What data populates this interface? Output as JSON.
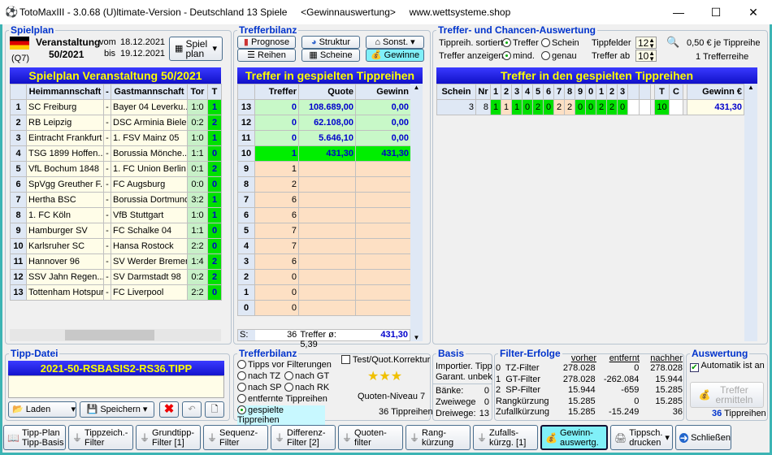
{
  "window": {
    "title": "TotoMaxIII - 3.0.68 (U)ltimate-Version - Deutschland 13 Spiele     <Gewinnauswertung>     www.wettsysteme.shop",
    "minimize": "—",
    "maximize": "☐",
    "close": "✕"
  },
  "spielplan": {
    "legend": "Spielplan",
    "q": "(Q7)",
    "veranstaltung_label": "Veranstaltung",
    "veranstaltung": "50/2021",
    "vom_label": "vom",
    "vom": "18.12.2021",
    "bis_label": "bis",
    "bis": "19.12.2021",
    "button": "Spiel plan",
    "title": "Spielplan Veranstaltung 50/2021",
    "headers": [
      "Heimmannschaft",
      "-",
      "Gastmannschaft",
      "Tor",
      "T"
    ],
    "rows": [
      {
        "nr": "1",
        "heim": "SC Freiburg",
        "gast": "Bayer 04 Leverku...",
        "tor": "1:0",
        "t": "1"
      },
      {
        "nr": "2",
        "heim": "RB Leipzig",
        "gast": "DSC Arminia Biele...",
        "tor": "0:2",
        "t": "2"
      },
      {
        "nr": "3",
        "heim": "Eintracht Frankfurt",
        "gast": "1. FSV Mainz 05",
        "tor": "1:0",
        "t": "1"
      },
      {
        "nr": "4",
        "heim": "TSG 1899 Hoffen...",
        "gast": "Borussia Mönche...",
        "tor": "1:1",
        "t": "0"
      },
      {
        "nr": "5",
        "heim": "VfL Bochum 1848",
        "gast": "1. FC Union Berlin",
        "tor": "0:1",
        "t": "2"
      },
      {
        "nr": "6",
        "heim": "SpVgg Greuther F...",
        "gast": "FC Augsburg",
        "tor": "0:0",
        "t": "0"
      },
      {
        "nr": "7",
        "heim": "Hertha BSC",
        "gast": "Borussia Dortmund",
        "tor": "3:2",
        "t": "1"
      },
      {
        "nr": "8",
        "heim": "1. FC Köln",
        "gast": "VfB Stuttgart",
        "tor": "1:0",
        "t": "1"
      },
      {
        "nr": "9",
        "heim": "Hamburger SV",
        "gast": "FC Schalke 04",
        "tor": "1:1",
        "t": "0"
      },
      {
        "nr": "10",
        "heim": "Karlsruher SC",
        "gast": "Hansa Rostock",
        "tor": "2:2",
        "t": "0"
      },
      {
        "nr": "11",
        "heim": "Hannover 96",
        "gast": "SV Werder Bremen",
        "tor": "1:4",
        "t": "2"
      },
      {
        "nr": "12",
        "heim": "SSV Jahn Regen...",
        "gast": "SV Darmstadt 98",
        "tor": "0:2",
        "t": "2"
      },
      {
        "nr": "13",
        "heim": "Tottenham Hotspur",
        "gast": "FC Liverpool",
        "tor": "2:2",
        "t": "0"
      }
    ]
  },
  "trefferbilanz": {
    "legend": "Trefferbilanz",
    "buttons": [
      "Prognose",
      "Struktur",
      "Sonst.",
      "Reihen",
      "Scheine",
      "Gewinne"
    ],
    "title": "Treffer in gespielten Tippreihen",
    "headers": [
      "Treffer",
      "Quote",
      "Gewinn"
    ],
    "rows": [
      {
        "nr": "13",
        "treffer": "0",
        "quote": "108.689,00",
        "gewinn": "0,00"
      },
      {
        "nr": "12",
        "treffer": "0",
        "quote": "62.108,00",
        "gewinn": "0,00"
      },
      {
        "nr": "11",
        "treffer": "0",
        "quote": "5.646,10",
        "gewinn": "0,00"
      },
      {
        "nr": "10",
        "treffer": "1",
        "quote": "431,30",
        "gewinn": "431,30"
      },
      {
        "nr": "9",
        "treffer": "1",
        "quote": "",
        "gewinn": ""
      },
      {
        "nr": "8",
        "treffer": "2",
        "quote": "",
        "gewinn": ""
      },
      {
        "nr": "7",
        "treffer": "6",
        "quote": "",
        "gewinn": ""
      },
      {
        "nr": "6",
        "treffer": "6",
        "quote": "",
        "gewinn": ""
      },
      {
        "nr": "5",
        "treffer": "7",
        "quote": "",
        "gewinn": ""
      },
      {
        "nr": "4",
        "treffer": "7",
        "quote": "",
        "gewinn": ""
      },
      {
        "nr": "3",
        "treffer": "6",
        "quote": "",
        "gewinn": ""
      },
      {
        "nr": "2",
        "treffer": "0",
        "quote": "",
        "gewinn": ""
      },
      {
        "nr": "1",
        "treffer": "0",
        "quote": "",
        "gewinn": ""
      },
      {
        "nr": "0",
        "treffer": "0",
        "quote": "",
        "gewinn": ""
      }
    ],
    "sum_label": "S:",
    "sum_treffer": "36",
    "avg": "Treffer ø: 5,39",
    "sum_gewinn": "431,30"
  },
  "chancen": {
    "legend": "Treffer- und Chancen-Auswertung",
    "sortiert_label": "Tippreih. sortiert:",
    "opt_treffer": "Treffer",
    "opt_schein": "Schein",
    "anzeigen_label": "Treffer anzeigen:",
    "opt_mind": "mind.",
    "opt_genau": "genau",
    "tippfelder_label": "Tippfelder",
    "tippfelder": "12",
    "treffer_ab_label": "Treffer ab",
    "treffer_ab": "10",
    "preis": "0,50 € je Tippreihe",
    "trefferreihe": "1 Trefferreihe",
    "title": "Treffer in den gespielten Tippreihen",
    "headers": {
      "schein": "Schein",
      "nr": "Nr",
      "games": [
        "1",
        "2",
        "3",
        "4",
        "5",
        "6",
        "7",
        "8",
        "9",
        "0",
        "1",
        "2",
        "3"
      ],
      "t": "T",
      "c": "C",
      "gewinn": "Gewinn €"
    },
    "row": {
      "schein": "3",
      "nr": "8",
      "tips": [
        "1",
        "1",
        "1",
        "0",
        "2",
        "0",
        "2",
        "2",
        "0",
        "0",
        "2",
        "2",
        "0"
      ],
      "hits": [
        true,
        false,
        true,
        true,
        true,
        true,
        false,
        false,
        true,
        true,
        true,
        true,
        true
      ],
      "t": "10",
      "gewinn": "431,30"
    }
  },
  "tippdatei": {
    "legend": "Tipp-Datei",
    "file": "2021-50-RSBASIS2-RS36.TIPP",
    "laden": "Laden",
    "speichern": "Speichern"
  },
  "bilanz2": {
    "legend": "Trefferbilanz",
    "options": [
      "Tipps vor Filterungen",
      "nach TZ",
      "nach GT",
      "nach SP",
      "nach RK",
      "entfernte Tippreihen",
      "gespielte Tippreihen"
    ],
    "selected": "gespielte Tippreihen",
    "test": "Test/Quot.Korrektur",
    "stars": "★★★",
    "niveau": "Quoten-Niveau 7",
    "tippreihen": "36 Tippreihen"
  },
  "basis": {
    "legend": "Basis",
    "line1": "Importier. Tipp",
    "line2": "Garant. unbek",
    "rows": [
      {
        "label": "Bänke:",
        "value": "0"
      },
      {
        "label": "Zweiwege",
        "value": "0"
      },
      {
        "label": "Dreiwege:",
        "value": "13"
      }
    ]
  },
  "filter": {
    "legend": "Filter-Erfolge",
    "headers": [
      "vorher",
      "entfernt",
      "nachher"
    ],
    "rows": [
      {
        "label": "0  TZ-Filter",
        "v": "278.028",
        "e": "0",
        "n": "278.028"
      },
      {
        "label": "1  GT-Filter",
        "v": "278.028",
        "e": "-262.084",
        "n": "15.944"
      },
      {
        "label": "2  SP-Filter",
        "v": "15.944",
        "e": "-659",
        "n": "15.285"
      },
      {
        "label": "Rangkürzung",
        "v": "15.285",
        "e": "0",
        "n": "15.285"
      },
      {
        "label": "Zufallkürzung",
        "v": "15.285",
        "e": "-15.249",
        "n": "36"
      }
    ]
  },
  "auswertung": {
    "legend": "Auswertung",
    "automatik": "Automatik ist an",
    "button": "Treffer ermitteln",
    "count": "36",
    "count_label": "Tippreihen"
  },
  "toolbar": [
    {
      "l1": "Tipp-Plan",
      "l2": "Tipp-Basis",
      "icon": "plan-icon"
    },
    {
      "l1": "Tippzeich.-",
      "l2": "Filter",
      "icon": "filter-icon"
    },
    {
      "l1": "Grundtipp-",
      "l2": "Filter [1]",
      "icon": "filter-icon"
    },
    {
      "l1": "Sequenz-",
      "l2": "Filter",
      "icon": "filter-icon"
    },
    {
      "l1": "Differenz-",
      "l2": "Filter [2]",
      "icon": "filter-icon"
    },
    {
      "l1": "Quoten-",
      "l2": "filter",
      "icon": "filter-icon"
    },
    {
      "l1": "Rang-",
      "l2": "kürzung",
      "icon": "filter-icon"
    },
    {
      "l1": "Zufalls-",
      "l2": "kürzg. [1]",
      "icon": "filter-icon"
    },
    {
      "l1": "Gewinn-",
      "l2": "auswertg.",
      "icon": "money-icon",
      "active": true
    },
    {
      "l1": "Tippsch.",
      "l2": "drucken",
      "icon": "printer-icon"
    },
    {
      "l1": "Schließen",
      "l2": "",
      "icon": "exit-icon"
    }
  ],
  "colors": {
    "blue_header": "#1a1ae0",
    "yellow_text": "#ffff00",
    "hit_green": "#00e000",
    "miss_peach": "#fde0c4",
    "active_cyan": "#80f0f8"
  }
}
